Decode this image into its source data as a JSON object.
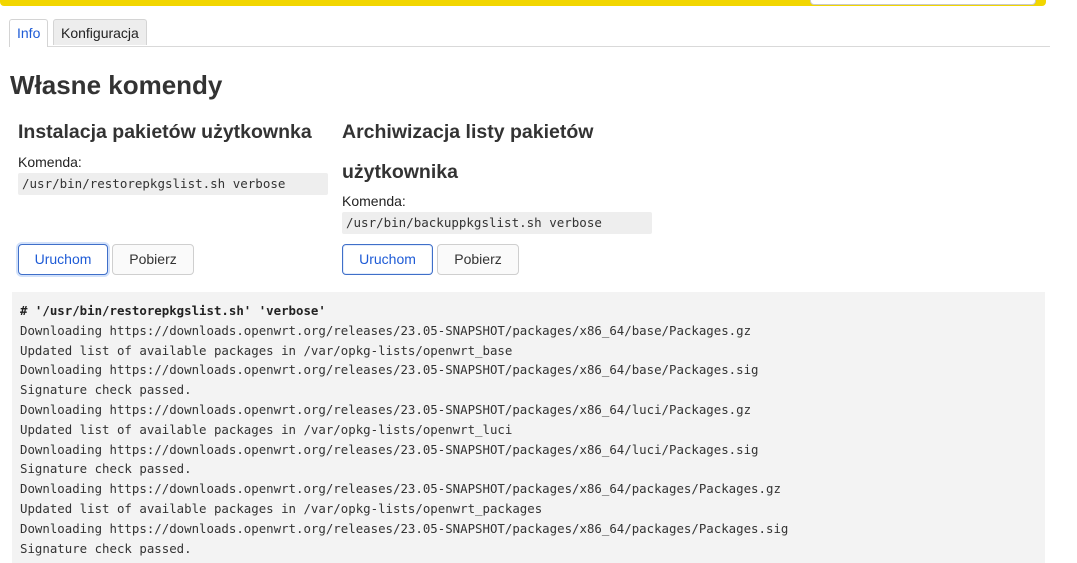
{
  "tabs": [
    {
      "label": "Info",
      "active": true
    },
    {
      "label": "Konfiguracja",
      "active": false
    }
  ],
  "page": {
    "title": "Własne komendy"
  },
  "commands": [
    {
      "title": "Instalacja pakietów użytkownka",
      "command_label": "Komenda:",
      "command": "/usr/bin/restorepkgslist.sh verbose",
      "run_label": "Uruchom",
      "download_label": "Pobierz"
    },
    {
      "title_line1": "Archiwizacja listy pakietów",
      "title_line2": "użytkownika",
      "command_label": "Komenda:",
      "command": "/usr/bin/backuppkgslist.sh verbose",
      "run_label": "Uruchom",
      "download_label": "Pobierz"
    }
  ],
  "output": {
    "command_line": "# '/usr/bin/restorepkgslist.sh' 'verbose'",
    "lines": [
      "Downloading https://downloads.openwrt.org/releases/23.05-SNAPSHOT/packages/x86_64/base/Packages.gz",
      "Updated list of available packages in /var/opkg-lists/openwrt_base",
      "Downloading https://downloads.openwrt.org/releases/23.05-SNAPSHOT/packages/x86_64/base/Packages.sig",
      "Signature check passed.",
      "Downloading https://downloads.openwrt.org/releases/23.05-SNAPSHOT/packages/x86_64/luci/Packages.gz",
      "Updated list of available packages in /var/opkg-lists/openwrt_luci",
      "Downloading https://downloads.openwrt.org/releases/23.05-SNAPSHOT/packages/x86_64/luci/Packages.sig",
      "Signature check passed.",
      "Downloading https://downloads.openwrt.org/releases/23.05-SNAPSHOT/packages/x86_64/packages/Packages.gz",
      "Updated list of available packages in /var/opkg-lists/openwrt_packages",
      "Downloading https://downloads.openwrt.org/releases/23.05-SNAPSHOT/packages/x86_64/packages/Packages.sig",
      "Signature check passed."
    ]
  },
  "colors": {
    "header_accent": "#f2d600",
    "primary_button": "#1e5bd6",
    "output_background": "#f3f3f3"
  }
}
